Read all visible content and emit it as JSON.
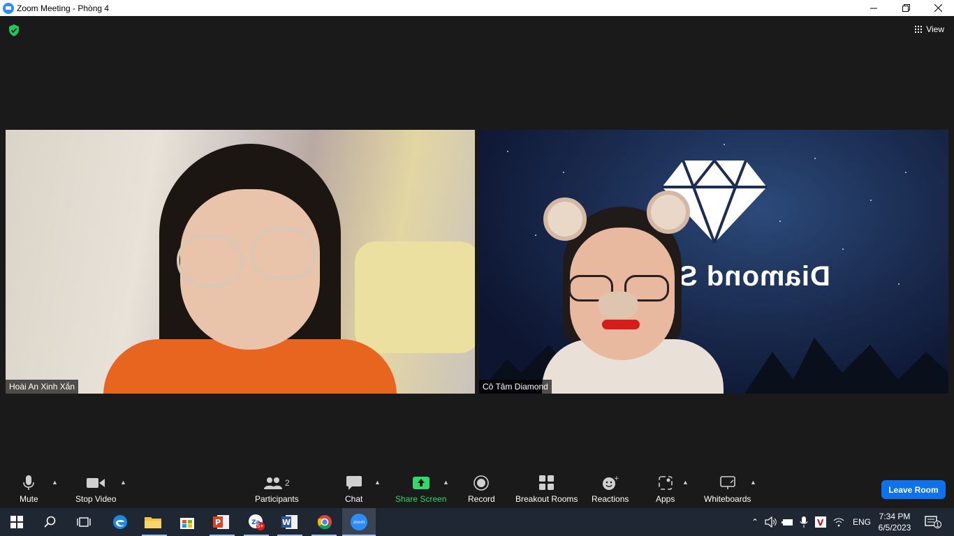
{
  "window": {
    "title": "Zoom Meeting - Phòng 4",
    "minimize_icon": "minimize-icon",
    "maximize_icon": "restore-icon",
    "close_icon": "close-icon"
  },
  "meeting": {
    "security_icon": "shield-check-icon",
    "view_label": "View",
    "participants": [
      {
        "name": "Hoài An Xinh Xắn"
      },
      {
        "name": "Cô Tâm Diamond"
      }
    ],
    "virtual_background_text": "Diamond S"
  },
  "toolbar": {
    "mute_label": "Mute",
    "stop_video_label": "Stop Video",
    "participants_label": "Participants",
    "participants_count": "2",
    "chat_label": "Chat",
    "share_screen_label": "Share Screen",
    "record_label": "Record",
    "breakout_rooms_label": "Breakout Rooms",
    "reactions_label": "Reactions",
    "apps_label": "Apps",
    "whiteboards_label": "Whiteboards",
    "leave_label": "Leave Room",
    "leave_color": "#0e72ed",
    "share_color": "#2fd96a"
  },
  "taskbar": {
    "badge_zalo": "5+",
    "language": "ENG",
    "time": "7:34 PM",
    "date": "6/5/2023",
    "notification_count": "1"
  }
}
